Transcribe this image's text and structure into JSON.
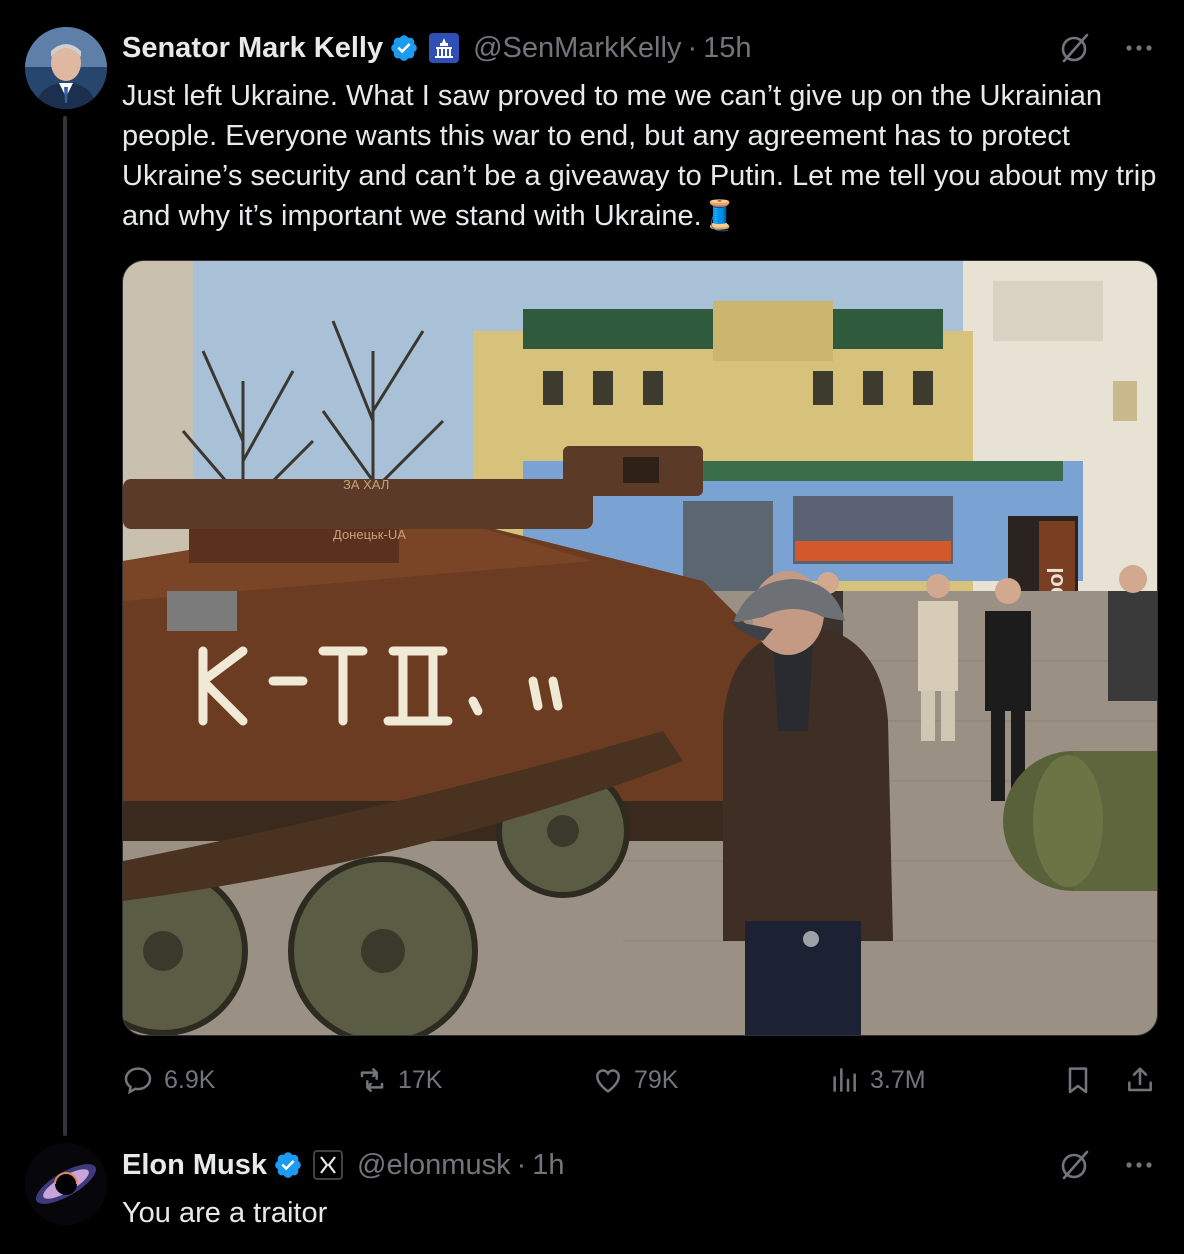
{
  "tweet1": {
    "author_name": "Senator Mark Kelly",
    "handle": "@SenMarkKelly",
    "separator": "·",
    "time": "15h",
    "text": "Just left Ukraine. What I saw proved to me we can’t give up on the Ukrainian people. Everyone wants this war to end, but any agreement has to protect Ukraine’s security and can’t be a giveaway to Putin. Let me tell you about my trip and why it’s important we stand with Ukraine.🧵",
    "media": {
      "sign_text": "Mariupol",
      "tank_markings": [
        "ЗА ХАЛ",
        "Донецьк-UA"
      ]
    },
    "actions": {
      "replies": "6.9K",
      "reposts": "17K",
      "likes": "79K",
      "views": "3.7M"
    }
  },
  "tweet2": {
    "author_name": "Elon Musk",
    "handle": "@elonmusk",
    "separator": "·",
    "time": "1h",
    "text": "You are a traitor"
  },
  "icons": {
    "verified_badge": "verified-check-icon",
    "kelly_affiliation": "capitol-building-icon",
    "musk_affiliation": "x-logo-icon",
    "grok": "grok-icon",
    "more": "more-dots-icon",
    "reply": "reply-bubble-icon",
    "repost": "repost-icon",
    "like": "heart-icon",
    "views": "views-bars-icon",
    "bookmark": "bookmark-icon",
    "share": "share-icon"
  },
  "colors": {
    "background": "#000000",
    "text_primary": "#e7e9ea",
    "text_secondary": "#71767b",
    "verified_blue": "#1d9bf0",
    "divider": "#2f3336"
  }
}
